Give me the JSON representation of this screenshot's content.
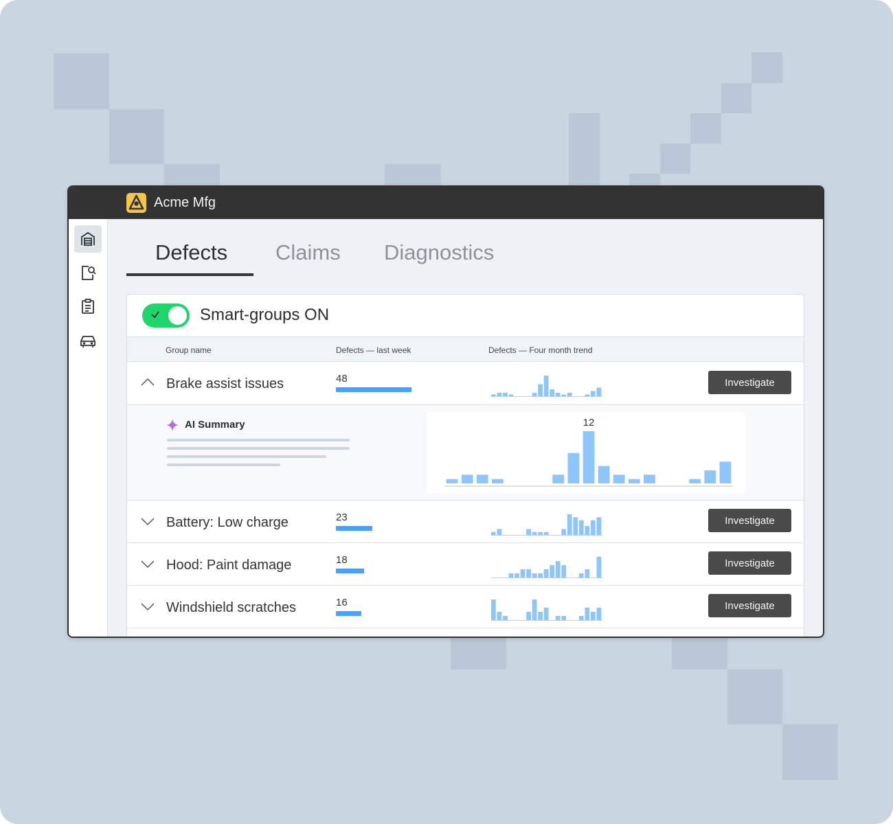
{
  "app": {
    "title": "Acme Mfg",
    "logo_icon": "acme-logo-icon"
  },
  "sidebar": {
    "items": [
      {
        "icon": "garage-icon",
        "active": true
      },
      {
        "icon": "document-search-icon",
        "active": false
      },
      {
        "icon": "clipboard-icon",
        "active": false
      },
      {
        "icon": "car-icon",
        "active": false
      }
    ]
  },
  "tabs": [
    {
      "label": "Defects",
      "active": true
    },
    {
      "label": "Claims",
      "active": false
    },
    {
      "label": "Diagnostics",
      "active": false
    }
  ],
  "smart_groups": {
    "label": "Smart-groups ON",
    "enabled": true
  },
  "table": {
    "headers": [
      "Group name",
      "Defects — last week",
      "Defects — Four month trend"
    ],
    "rows": [
      {
        "name": "Brake assist issues",
        "count": "48",
        "count_value": 48,
        "expanded": true,
        "trend": [
          1,
          2,
          2,
          1,
          0,
          0,
          0,
          2,
          7,
          12,
          4,
          2,
          1,
          2,
          0,
          0,
          1,
          3,
          5
        ],
        "action": "Investigate"
      },
      {
        "name": "Battery: Low charge",
        "count": "23",
        "count_value": 23,
        "expanded": false,
        "trend": [
          1,
          2,
          0,
          0,
          0,
          0,
          2,
          1,
          1,
          1,
          0,
          0,
          2,
          7,
          6,
          5,
          3,
          5,
          6
        ],
        "action": "Investigate"
      },
      {
        "name": "Hood: Paint damage",
        "count": "18",
        "count_value": 18,
        "expanded": false,
        "trend": [
          0,
          0,
          0,
          1,
          1,
          2,
          2,
          1,
          1,
          2,
          3,
          4,
          3,
          0,
          0,
          1,
          2,
          0,
          5
        ],
        "action": "Investigate"
      },
      {
        "name": "Windshield scratches",
        "count": "16",
        "count_value": 16,
        "expanded": false,
        "trend": [
          5,
          2,
          1,
          0,
          0,
          0,
          2,
          5,
          2,
          3,
          0,
          1,
          1,
          0,
          0,
          1,
          3,
          2,
          3
        ],
        "action": "Investigate"
      }
    ]
  },
  "ai_summary": {
    "title": "AI Summary",
    "icon": "sparkle-icon"
  },
  "chart_data": {
    "type": "bar",
    "title": "",
    "values": [
      1,
      2,
      2,
      1,
      0,
      0,
      0,
      2,
      7,
      12,
      4,
      2,
      1,
      2,
      0,
      0,
      1,
      3,
      5
    ],
    "annotations": [
      {
        "index": 9,
        "label": "12"
      }
    ]
  },
  "colors": {
    "accent_bar": "#4da0f5",
    "spark_bar": "#8ec6fb",
    "toggle_on": "#1fd66a",
    "titlebar": "#333333",
    "logo": "#f5c54a"
  }
}
